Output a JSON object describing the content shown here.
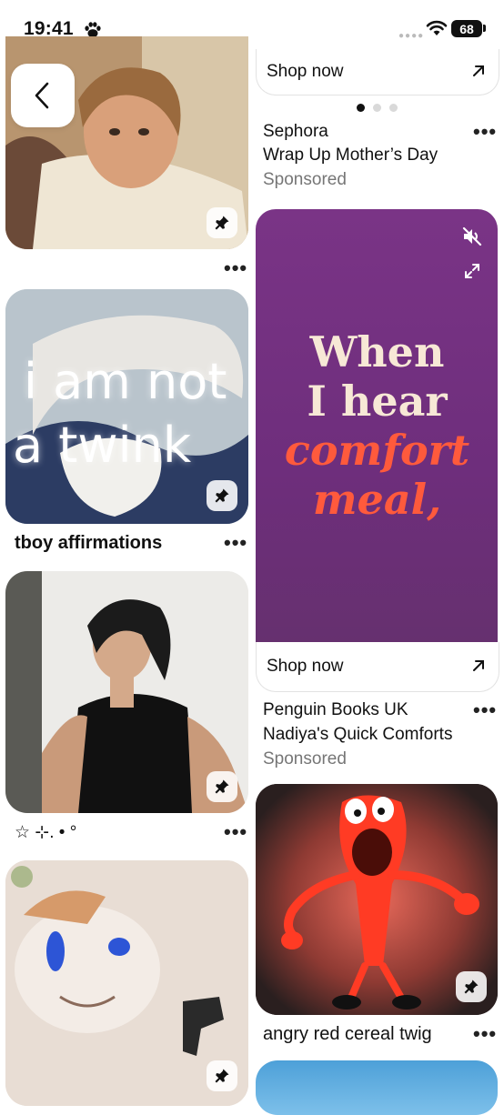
{
  "status_bar": {
    "time": "19:41",
    "battery": "68"
  },
  "feed": {
    "left": [
      {
        "title": ""
      },
      {
        "title": "tboy affirmations",
        "overlay_text": [
          "i am not",
          "a twink"
        ]
      },
      {
        "title": "☆ ⊹. • °"
      },
      {
        "title": ""
      }
    ],
    "right": {
      "sephora_ad": {
        "shop_label": "Shop now",
        "advertiser": "Sephora",
        "subtitle": "Wrap Up Mother’s Day",
        "sponsored": "Sponsored"
      },
      "penguin_ad": {
        "promo_lines": [
          "When",
          "I hear",
          "comfort",
          "meal,"
        ],
        "shop_label": "Shop now",
        "advertiser": "Penguin Books UK",
        "subtitle": "Nadiya's Quick Comforts",
        "sponsored": "Sponsored"
      },
      "twig_pin": {
        "title": "angry red cereal twig"
      }
    }
  },
  "more_label": "•••",
  "colors": {
    "promo_bg": "#7a3486",
    "promo_cream": "#f7e8d6",
    "promo_orange": "#ff5a3c",
    "sponsored_gray": "#767676"
  }
}
